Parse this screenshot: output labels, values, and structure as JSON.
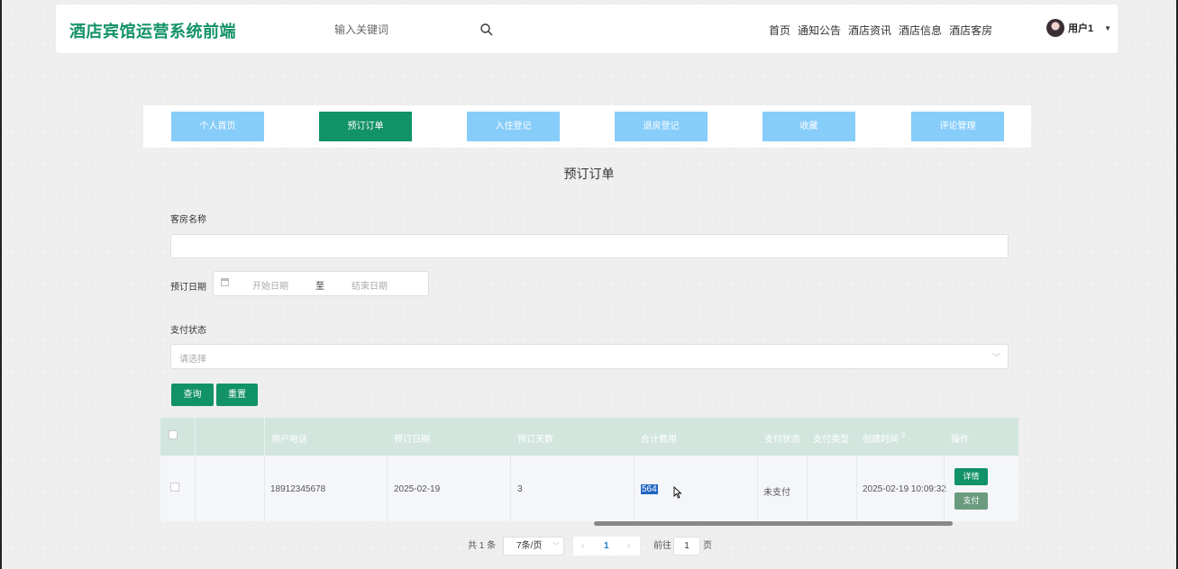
{
  "header": {
    "brand": "酒店宾馆运营系统前端",
    "search_placeholder": "输入关键词",
    "nav": [
      "首页",
      "通知公告",
      "酒店资讯",
      "酒店信息",
      "酒店客房"
    ],
    "user_name": "用户1"
  },
  "tabs": [
    "个人首页",
    "预订订单",
    "入住登记",
    "退房登记",
    "收藏",
    "评论管理"
  ],
  "active_tab": "预订订单",
  "page_title": "预订订单",
  "form": {
    "room_label": "客房名称",
    "room_value": "",
    "date_label": "预订日期",
    "date_start_placeholder": "开始日期",
    "date_separator": "至",
    "date_end_placeholder": "结束日期",
    "pay_status_label": "支付状态",
    "pay_status_placeholder": "请选择",
    "query_button": "查询",
    "reset_button": "重置"
  },
  "table": {
    "columns": [
      "用户电话",
      "预订日期",
      "预订天数",
      "合计费用",
      "支付状态",
      "支付类型",
      "创建时间",
      "操作"
    ],
    "rows": [
      {
        "phone": "18912345678",
        "date": "2025-02-19",
        "days": "3",
        "total": "564",
        "pay_status": "未支付",
        "pay_type": "",
        "created": "2025-02-19 10:09:32",
        "detail_button": "详情",
        "pay_button": "支付"
      }
    ]
  },
  "pagination": {
    "total_text": "共 1 条",
    "page_size": "7条/页",
    "current_page": "1",
    "goto_label": "前往",
    "goto_value": "1",
    "page_suffix": "页"
  },
  "colors": {
    "primary": "#129267",
    "tab_inactive": "#87cdfa",
    "table_header": "#d2e6de",
    "pay_button": "#6b9b7f"
  }
}
